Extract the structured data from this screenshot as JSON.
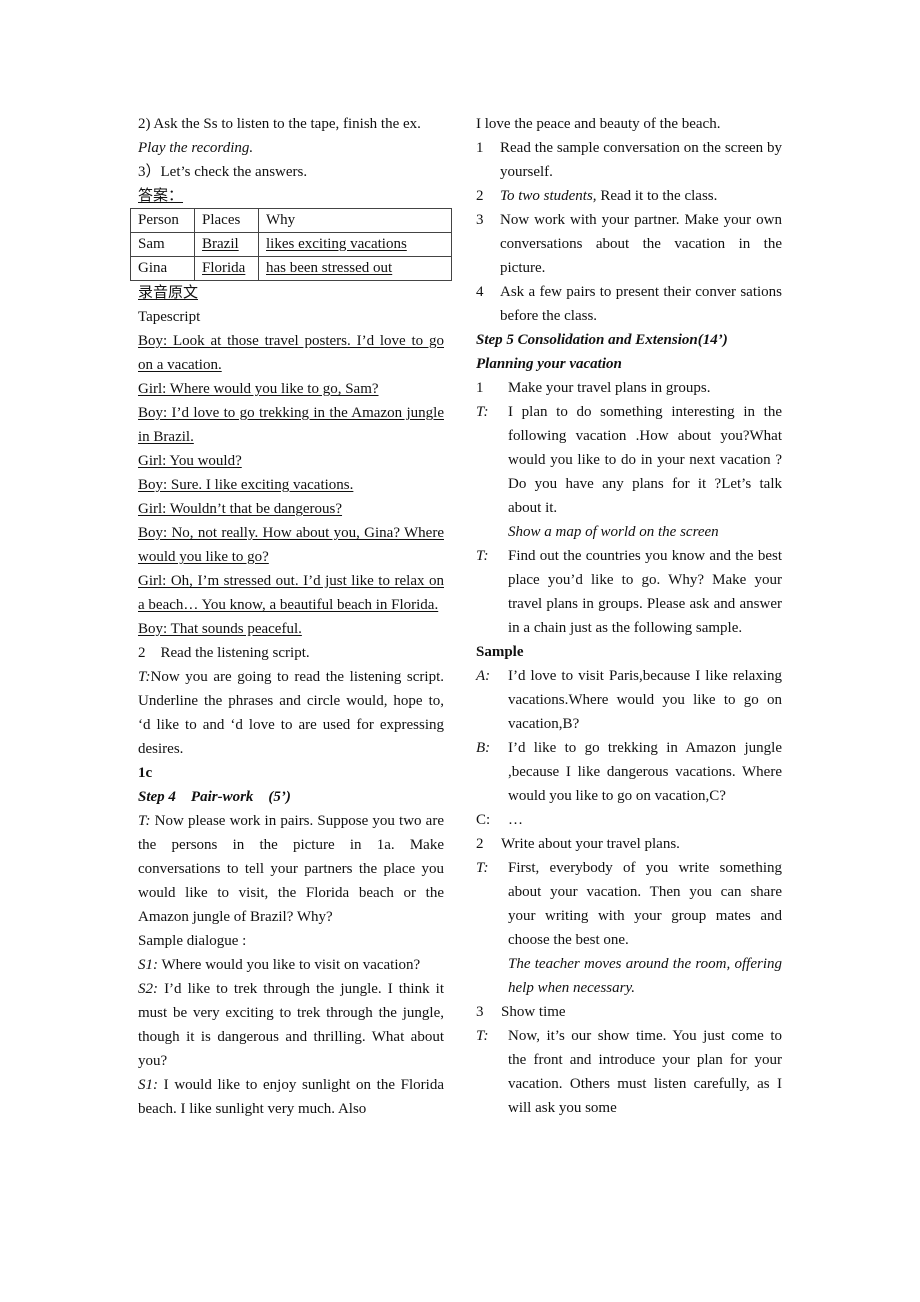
{
  "left": {
    "l0": "2) Ask the Ss to listen to the tape, finish the ex.",
    "l1": "Play the recording.",
    "l2": "3）Let’s check the answers.",
    "answers_label": "答案：",
    "table": {
      "headers": [
        "Person",
        "Places",
        "Why"
      ],
      "rows": [
        [
          "Sam",
          "Brazil",
          "likes exciting vacations"
        ],
        [
          "Gina",
          "Florida",
          "has been stressed out"
        ]
      ]
    },
    "script_label": "录音原文",
    "tapescript_label": "Tapescript",
    "tapescript": [
      "Boy: Look at those travel posters. I’d love to go on a vacation. ",
      "Girl: Where would you like to go, Sam? ",
      "Boy: I’d love to go trekking in the Amazon jungle in Brazil. ",
      "Girl: You would? ",
      "Boy: Sure. I like exciting vacations. ",
      "Girl: Wouldn’t that be dangerous? ",
      "Boy: No, not really. How about you, Gina? Where would you like to go? ",
      "Girl: Oh, I’m stressed out. I’d just like to relax on a beach… You know, a beautiful beach in Florida. ",
      "Boy: That sounds peaceful. "
    ],
    "read_num": "2",
    "read_text": "Read the listening script.",
    "t_label": "T:",
    "t_text": "Now you are going to read the listening script. Underline the phrases and circle would, hope to, ‘d like to and ‘d love to are used for expressing desires.",
    "section_1c": "1c",
    "step4": "Step 4    Pair-work    (5’)",
    "t2_label": "T:",
    "t2_text": " Now please work in pairs. Suppose you two are the persons in the picture in 1a. Make conversations to tell your partners the place you would like to visit, the Florida beach or the Amazon jungle of Brazil? Why?",
    "sample_dialogue": "Sample dialogue :",
    "s1a_label": "S1:",
    "s1a_text": " Where would you like to visit on vacation?",
    "s2_label": "S2:",
    "s2_text": " I’d like to trek through the jungle. I think it must be very exciting to trek through the jungle, though it is dangerous and thrilling. What about you?",
    "s1b_label": "S1:",
    "s1b_text": " I would like to enjoy sunlight on the Florida beach. I like sunlight very much. Also"
  },
  "right": {
    "r0": "I love the peace and beauty of the beach.",
    "items": [
      {
        "num": "1",
        "text": " Read the sample conversation on the screen by yourself."
      },
      {
        "num": "2",
        "italic": "To two students,",
        "text": " Read it to the class."
      },
      {
        "num": "3",
        "text": " Now work with your partner. Make your own conversations about the vacation in the picture."
      },
      {
        "num": "4",
        "text": "Ask a few pairs to present their conver sations before the class."
      }
    ],
    "step5": "Step 5 Consolidation and Extension(14’)",
    "planning": "Planning your vacation",
    "p1_num": "1",
    "p1_text": "Make your travel plans in groups.",
    "t1_label": "T:",
    "t1_text": " I plan to do something interesting in the following vacation .How about you?What would you like to do in your next vacation ?Do you have any plans for it ?Let’s talk about it.",
    "t1_note": "Show a map of world on the screen",
    "t2_label": "T:",
    "t2_text": "Find out the countries you know and the best place you’d like to go.   Why? Make your travel plans in groups. Please ask and answer in a chain just as the following sample.",
    "sample": "Sample",
    "a_label": "A:",
    "a_text": "I’d love to visit Paris,because I like relaxing vacations.Where would you like to go on vacation,B?",
    "b_label": "B:",
    "b_text": "I’d like to go trekking in Amazon jungle ,because I like dangerous vacations. Where would you like to go on vacation,C?",
    "c_label": "C:",
    "c_text": "…",
    "p2_num": "2",
    "p2_text": "Write about your travel plans.",
    "t3_label": "T:",
    "t3_text": " First, everybody of you write something about your vacation. Then you can share your writing with your group mates and choose the best one.",
    "t3_note": "The teacher moves around the room, offering help when necessary.",
    "p3_num": "3",
    "p3_text": "Show time",
    "t4_label": "T:",
    "t4_text": " Now, it’s our show time. You just come to the front and introduce your plan for your vacation. Others must listen carefully, as I will ask you some"
  }
}
